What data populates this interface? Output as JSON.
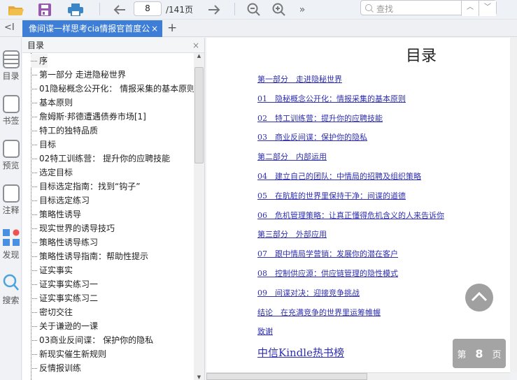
{
  "toolbar": {
    "page_current": "8",
    "page_total": "/141页",
    "search_placeholder": "查找",
    "more": "»"
  },
  "tab": {
    "title": "像间谍一样思考cia情报官首度公",
    "close": "×",
    "add": "+",
    "collapse": "<I"
  },
  "sidebar": {
    "items": [
      {
        "label": "目录"
      },
      {
        "label": "书签"
      },
      {
        "label": "预览"
      },
      {
        "label": "注释"
      },
      {
        "label": "发现"
      },
      {
        "label": "搜索"
      }
    ]
  },
  "toc": {
    "title": "目录",
    "close": "×",
    "items": [
      "序",
      "第一部分 走进隐秘世界",
      "01隐秘概念公开化： 情报采集的基本原则",
      "基本原则",
      "詹姆斯·邦德遭遇债券市场[1]",
      "特工的独特品质",
      "目标",
      "02特工训练营： 提升你的应聘技能",
      "选定目标",
      "目标选定指南：找到“钩子”",
      "目标选定练习",
      "策略性诱导",
      "现实世界的诱导技巧",
      "策略性诱导练习",
      "策略性诱导指南：帮助性提示",
      "证实事实",
      "证实事实练习一",
      "证实事实练习二",
      "密切交往",
      "关于谦逊的一课",
      "03商业反间谍： 保护你的隐私",
      "新现实催生新规则",
      "反情报训练"
    ]
  },
  "document": {
    "title": "目录",
    "links": [
      "第一部分　走进隐秘世界",
      "01　隐秘概念公开化：情报采集的基本原则",
      "02　特工训练营：提升你的应聘技能",
      "03　商业反间谍：保护你的隐私",
      "第二部分　内部运用",
      "04　建立自己的团队：中情局的招聘及组织策略",
      "05　在肮脏的世界里保持干净：间谍的道德",
      "06　危机管理策略：让真正懂得危机含义的人来告诉你",
      "第三部分　外部应用",
      "07　跟中情局学营销：发展你的潜在客户",
      "08　控制供应源：供应链管理的隐性模式",
      "09　间谍对决：迎接竞争挑战",
      "结论　在充满竞争的世界里运筹帷幄",
      "致谢"
    ],
    "big_link": "中信Kindle热书榜"
  },
  "page_badge": {
    "prefix": "第",
    "number": "8",
    "suffix": "页"
  },
  "colors": {
    "accent": "#3e7ed6",
    "link": "#2f2fb0"
  }
}
